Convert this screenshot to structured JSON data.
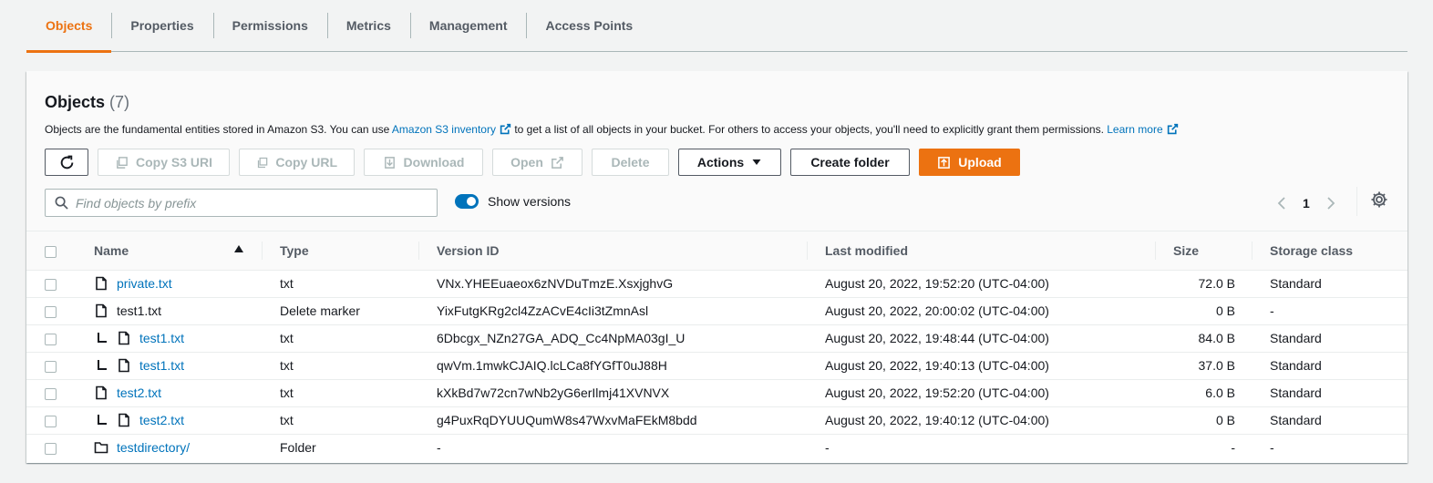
{
  "tabs": [
    {
      "label": "Objects",
      "active": true
    },
    {
      "label": "Properties",
      "active": false
    },
    {
      "label": "Permissions",
      "active": false
    },
    {
      "label": "Metrics",
      "active": false
    },
    {
      "label": "Management",
      "active": false
    },
    {
      "label": "Access Points",
      "active": false
    }
  ],
  "header": {
    "title": "Objects",
    "count": "(7)",
    "desc_pre": "Objects are the fundamental entities stored in Amazon S3. You can use ",
    "desc_link1": "Amazon S3 inventory",
    "desc_mid": " to get a list of all objects in your bucket. For others to access your objects, you'll need to explicitly grant them permissions. ",
    "desc_link2": "Learn more"
  },
  "toolbar": {
    "refresh_icon": "refresh-icon",
    "copy_s3_uri": "Copy S3 URI",
    "copy_url": "Copy URL",
    "download": "Download",
    "open": "Open",
    "delete": "Delete",
    "actions": "Actions",
    "create_folder": "Create folder",
    "upload": "Upload"
  },
  "search": {
    "placeholder": "Find objects by prefix",
    "value": ""
  },
  "versions_toggle": {
    "label": "Show versions",
    "on": true
  },
  "pager": {
    "page": "1"
  },
  "table": {
    "headers": [
      "Name",
      "Type",
      "Version ID",
      "Last modified",
      "Size",
      "Storage class"
    ],
    "rows": [
      {
        "name": "private.txt",
        "is_link": true,
        "child": false,
        "icon": "file-icon",
        "type": "txt",
        "version": "VNx.YHEEuaeox6zNVDuTmzE.XsxjghvG",
        "modified": "August 20, 2022, 19:52:20 (UTC-04:00)",
        "size": "72.0 B",
        "storage": "Standard"
      },
      {
        "name": "test1.txt",
        "is_link": false,
        "child": false,
        "icon": "file-icon",
        "type": "Delete marker",
        "version": "YixFutgKRg2cl4ZzACvE4cIi3tZmnAsl",
        "modified": "August 20, 2022, 20:00:02 (UTC-04:00)",
        "size": "0 B",
        "storage": "-"
      },
      {
        "name": "test1.txt",
        "is_link": true,
        "child": true,
        "icon": "file-icon",
        "type": "txt",
        "version": "6Dbcgx_NZn27GA_ADQ_Cc4NpMA03gI_U",
        "modified": "August 20, 2022, 19:48:44 (UTC-04:00)",
        "size": "84.0 B",
        "storage": "Standard"
      },
      {
        "name": "test1.txt",
        "is_link": true,
        "child": true,
        "icon": "file-icon",
        "type": "txt",
        "version": "qwVm.1mwkCJAIQ.lcLCa8fYGfT0uJ88H",
        "modified": "August 20, 2022, 19:40:13 (UTC-04:00)",
        "size": "37.0 B",
        "storage": "Standard"
      },
      {
        "name": "test2.txt",
        "is_link": true,
        "child": false,
        "icon": "file-icon",
        "type": "txt",
        "version": "kXkBd7w72cn7wNb2yG6erIlmj41XVNVX",
        "modified": "August 20, 2022, 19:52:20 (UTC-04:00)",
        "size": "6.0 B",
        "storage": "Standard"
      },
      {
        "name": "test2.txt",
        "is_link": true,
        "child": true,
        "icon": "file-icon",
        "type": "txt",
        "version": "g4PuxRqDYUUQumW8s47WxvMaFEkM8bdd",
        "modified": "August 20, 2022, 19:40:12 (UTC-04:00)",
        "size": "0 B",
        "storage": "Standard"
      },
      {
        "name": "testdirectory/",
        "is_link": true,
        "child": false,
        "icon": "folder-icon",
        "type": "Folder",
        "version": "-",
        "modified": "-",
        "size": "-",
        "storage": "-"
      }
    ]
  },
  "colors": {
    "accent": "#ec7211",
    "link": "#0073bb",
    "text": "#16191f"
  }
}
